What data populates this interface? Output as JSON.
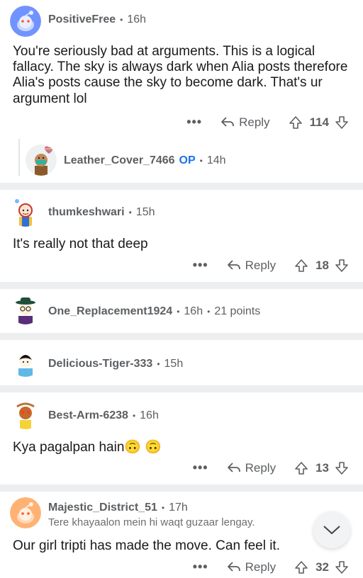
{
  "comments": [
    {
      "username": "PositiveFree",
      "age": "16h",
      "body": "You're seriously bad at arguments. This is a logical fallacy. The sky is always dark when Alia posts therefore Alia's posts cause the sky to become dark. That's ur argument lol",
      "more": "•••",
      "reply_label": "Reply",
      "score": "114"
    },
    {
      "username": "Leather_Cover_7466",
      "op_badge": "OP",
      "age": "14h"
    },
    {
      "username": "thumkeshwari",
      "age": "15h",
      "body": "It's really not that deep",
      "more": "•••",
      "reply_label": "Reply",
      "score": "18"
    },
    {
      "username": "One_Replacement1924",
      "age": "16h",
      "points": "21 points"
    },
    {
      "username": "Delicious-Tiger-333",
      "age": "15h"
    },
    {
      "username": "Best-Arm-6238",
      "age": "16h",
      "body": "Kya pagalpan hain",
      "emoji": "🙃 🙃",
      "more": "•••",
      "reply_label": "Reply",
      "score": "13"
    },
    {
      "username": "Majestic_District_51",
      "age": "17h",
      "flair": "Tere khayaalon mein hi waqt guzaar lengay.",
      "body": "Our girl tripti has made the move. Can feel it.",
      "more": "•••",
      "reply_label": "Reply",
      "score": "32"
    }
  ],
  "separator": "•",
  "colors": {
    "op": "#1a73e8",
    "divider": "#eceef0",
    "meta": "#5c5f62"
  },
  "icons": [
    "reply-arrow-icon",
    "upvote-icon",
    "downvote-icon",
    "chevron-down-icon",
    "avatar"
  ]
}
